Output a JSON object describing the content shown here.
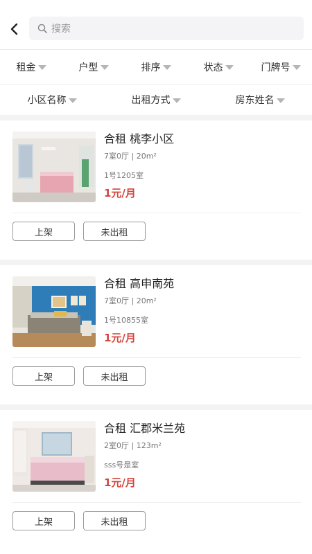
{
  "header": {
    "search_placeholder": "搜索"
  },
  "filters_row1": [
    "租金",
    "户型",
    "排序",
    "状态",
    "门牌号"
  ],
  "filters_row2": [
    "小区名称",
    "出租方式",
    "房东姓名"
  ],
  "listings": [
    {
      "title": "合租 桃李小区",
      "spec": "7室0厅 | 20m²",
      "room": "1号1205室",
      "price": "1元/月",
      "btn_list": "上架",
      "btn_status": "未出租"
    },
    {
      "title": "合租 高申南苑",
      "spec": "7室0厅 | 20m²",
      "room": "1号10855室",
      "price": "1元/月",
      "btn_list": "上架",
      "btn_status": "未出租"
    },
    {
      "title": "合租 汇郡米兰苑",
      "spec": "2室0厅 | 123m²",
      "room": "sss号是室",
      "price": "1元/月",
      "btn_list": "上架",
      "btn_status": "未出租"
    }
  ],
  "icons": {
    "back": "chevron-left-icon",
    "search": "search-icon",
    "caret": "caret-down-icon"
  }
}
